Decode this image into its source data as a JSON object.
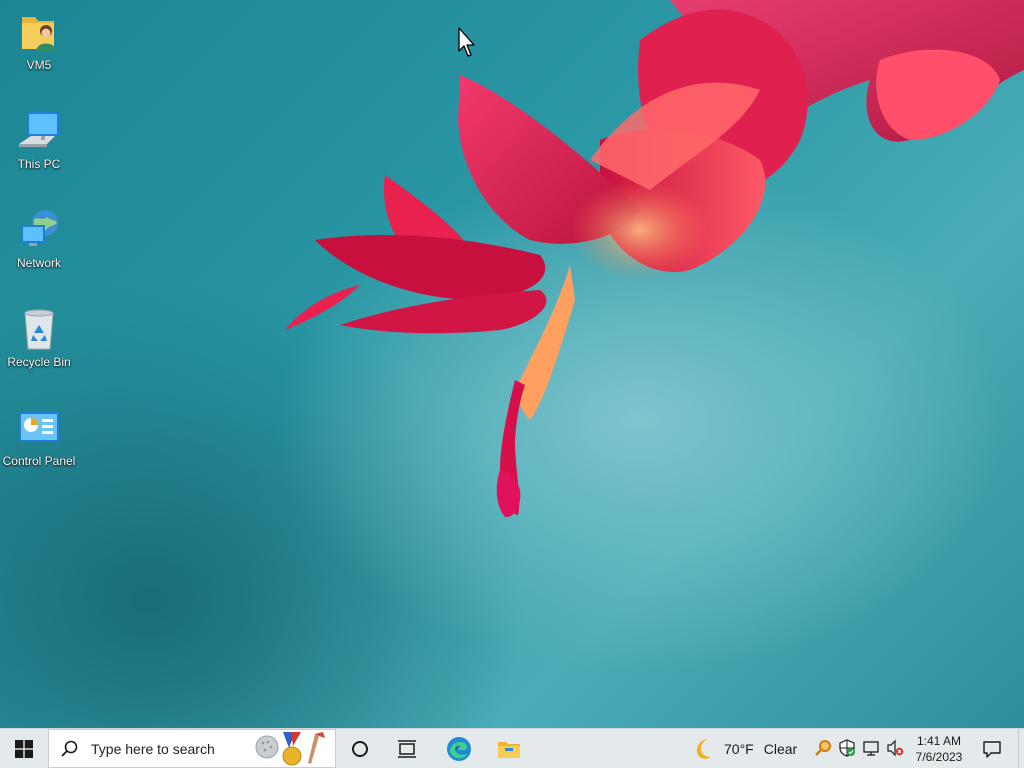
{
  "desktop": {
    "icons": [
      {
        "label": "VM5",
        "icon": "user-folder-icon"
      },
      {
        "label": "This PC",
        "icon": "computer-icon"
      },
      {
        "label": "Network",
        "icon": "network-icon"
      },
      {
        "label": "Recycle Bin",
        "icon": "recycle-bin-icon"
      },
      {
        "label": "Control Panel",
        "icon": "control-panel-icon"
      }
    ],
    "wallpaper": "pink-flower-on-teal",
    "colors": {
      "flower": "#e8194f",
      "background": "#2a97a4"
    }
  },
  "taskbar": {
    "search": {
      "placeholder": "Type here to search"
    },
    "apps": [
      "cortana-icon",
      "task-view-icon",
      "edge-icon",
      "file-explorer-icon"
    ],
    "weather": {
      "temperature": "70°F",
      "condition": "Clear",
      "icon": "moon-icon"
    },
    "tray_icons": [
      "magnifier-icon",
      "security-shield-icon",
      "network-monitor-icon",
      "speaker-muted-icon"
    ],
    "clock": {
      "time": "1:41 AM",
      "date": "7/6/2023"
    },
    "notification_icon": "action-center-icon"
  }
}
